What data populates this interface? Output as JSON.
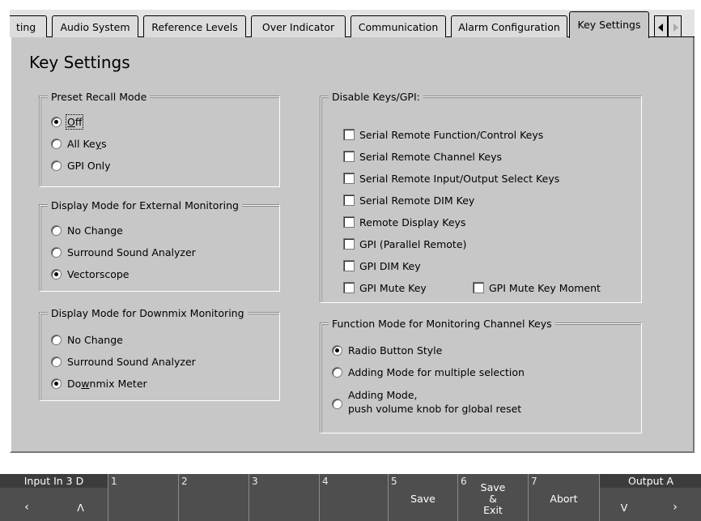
{
  "tabs": [
    {
      "label": "ting"
    },
    {
      "label": "Audio System"
    },
    {
      "label": "Reference Levels"
    },
    {
      "label": "Over Indicator"
    },
    {
      "label": "Communication"
    },
    {
      "label": "Alarm Configuration"
    },
    {
      "label": "Key Settings"
    }
  ],
  "page_title": "Key Settings",
  "preset_recall": {
    "legend": "Preset Recall Mode",
    "options": [
      "Off",
      "All Keys",
      "GPI Only"
    ],
    "selected": "Off"
  },
  "external_monitoring": {
    "legend": "Display Mode for External Monitoring",
    "options": [
      "No Change",
      "Surround Sound Analyzer",
      "Vectorscope"
    ],
    "selected": "Vectorscope"
  },
  "downmix_monitoring": {
    "legend": "Display Mode for Downmix Monitoring",
    "options": [
      "No Change",
      "Surround Sound Analyzer",
      "Downmix Meter"
    ],
    "selected": "Downmix Meter"
  },
  "disable_keys": {
    "legend": "Disable Keys/GPI:",
    "items": [
      {
        "label": "Serial Remote Function/Control Keys",
        "checked": false
      },
      {
        "label": "Serial Remote Channel Keys",
        "checked": false
      },
      {
        "label": "Serial Remote Input/Output Select Keys",
        "checked": false
      },
      {
        "label": "Serial Remote DIM Key",
        "checked": false
      },
      {
        "label": "Remote Display Keys",
        "checked": false
      },
      {
        "label": "GPI (Parallel Remote)",
        "checked": false
      },
      {
        "label": "GPI DIM Key",
        "checked": false
      },
      {
        "label": "GPI Mute Key",
        "checked": false
      },
      {
        "label": "GPI Mute Key Moment",
        "checked": false
      }
    ]
  },
  "function_mode": {
    "legend": "Function Mode for Monitoring Channel Keys",
    "options": [
      "Radio Button Style",
      "Adding Mode for multiple selection",
      "Adding Mode,",
      "push volume knob for global reset"
    ],
    "selected": "Radio Button Style"
  },
  "function_bar": {
    "input_label": "Input In 3 D",
    "prev_glyph": "‹",
    "up_glyph": "Λ",
    "slots": [
      "1",
      "2",
      "3",
      "4",
      "5",
      "6",
      "7"
    ],
    "save_label": "Save",
    "save_exit_label": [
      "Save",
      "&",
      "Exit"
    ],
    "abort_label": "Abort",
    "output_label": "Output A",
    "down_glyph": "V",
    "next_glyph": "›"
  },
  "colors": {
    "panel": "#c7c7c7",
    "function_bar": "#4e4e4e"
  }
}
